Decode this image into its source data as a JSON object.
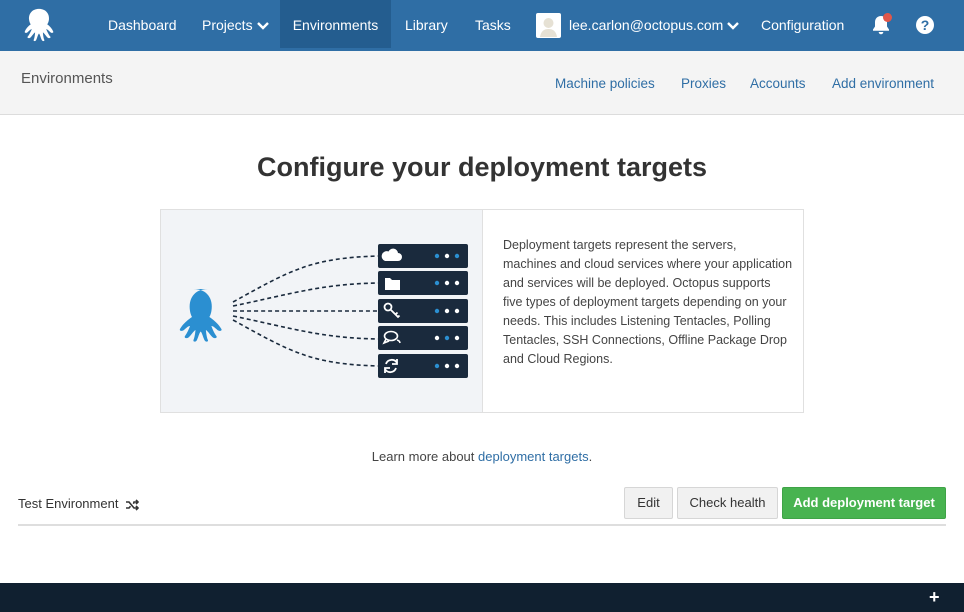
{
  "nav": {
    "items": [
      {
        "label": "Dashboard"
      },
      {
        "label": "Projects"
      },
      {
        "label": "Environments"
      },
      {
        "label": "Library"
      },
      {
        "label": "Tasks"
      }
    ],
    "user_email": "lee.carlon@octopus.com",
    "configuration": "Configuration",
    "help_symbol": "?",
    "icons": [
      "octopus-logo-icon",
      "chevron-down-icon",
      "bell-icon",
      "help-icon"
    ],
    "colors": {
      "nav_bg": "#2f6ea5",
      "active_bg": "#245d8f",
      "notification_dot": "#e0574a"
    }
  },
  "subheader": {
    "title": "Environments",
    "links": [
      "Machine policies",
      "Proxies",
      "Accounts",
      "Add environment"
    ]
  },
  "main": {
    "title": "Configure your deployment targets",
    "description": "Deployment targets represent the servers, machines and cloud services where your application and services will be deployed. Octopus supports five types of deployment targets depending on your needs. This includes Listening Tentacles, Polling Tentacles, SSH Connections, Offline Package Drop and Cloud Regions.",
    "illustration_icons": [
      "cloud-icon",
      "folder-icon",
      "key-icon",
      "chat-icon",
      "refresh-icon"
    ],
    "learn_prefix": "Learn more about ",
    "learn_link": "deployment targets",
    "learn_suffix": "."
  },
  "environment": {
    "name": "Test Environment",
    "buttons": {
      "edit": "Edit",
      "check_health": "Check health",
      "add_target": "Add deployment target"
    },
    "colors": {
      "primary": "#48b350"
    }
  },
  "footer": {
    "plus_symbol": "+"
  }
}
